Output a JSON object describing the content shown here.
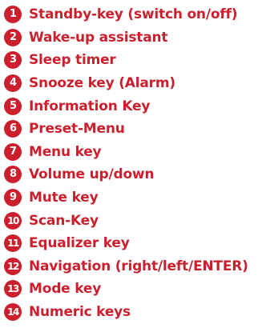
{
  "colors": {
    "accent": "#cc1f2d",
    "badge_text": "#ffffff",
    "background": "#ffffff"
  },
  "legend": {
    "items": [
      {
        "number": "1",
        "label": "Standby-key (switch on/off)"
      },
      {
        "number": "2",
        "label": "Wake-up assistant"
      },
      {
        "number": "3",
        "label": "Sleep timer"
      },
      {
        "number": "4",
        "label": "Snooze key (Alarm)"
      },
      {
        "number": "5",
        "label": "Information Key"
      },
      {
        "number": "6",
        "label": "Preset-Menu"
      },
      {
        "number": "7",
        "label": "Menu key"
      },
      {
        "number": "8",
        "label": "Volume up/down"
      },
      {
        "number": "9",
        "label": "Mute key"
      },
      {
        "number": "10",
        "label": "Scan-Key"
      },
      {
        "number": "11",
        "label": "Equalizer key"
      },
      {
        "number": "12",
        "label": "Navigation (right/left/ENTER)"
      },
      {
        "number": "13",
        "label": "Mode key"
      },
      {
        "number": "14",
        "label": "Numeric keys"
      }
    ]
  }
}
